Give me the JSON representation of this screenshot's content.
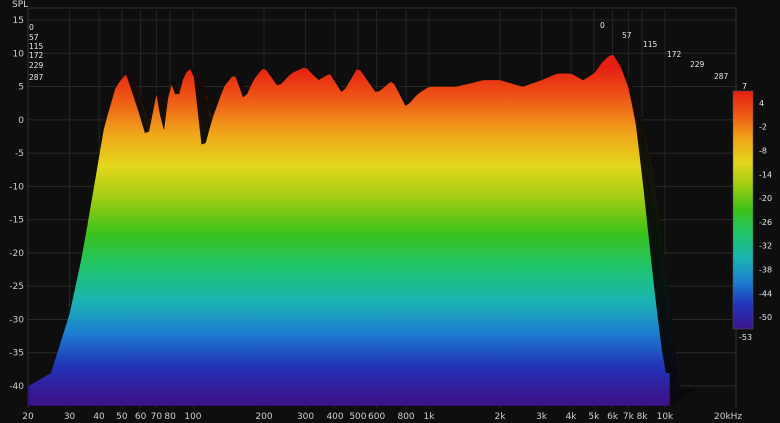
{
  "chart_data": {
    "type": "area",
    "title": "",
    "ylabel": "SPL",
    "xunit_label": "20kHz",
    "xscale": "log",
    "xlim": [
      20,
      20000
    ],
    "ylim": [
      -43,
      16
    ],
    "grid": true,
    "y_ticks": [
      15,
      10,
      5,
      0,
      -5,
      -10,
      -15,
      -20,
      -25,
      -30,
      -35,
      -40
    ],
    "x_ticks": [
      {
        "value": 20,
        "label": "20"
      },
      {
        "value": 30,
        "label": "30"
      },
      {
        "value": 40,
        "label": "40"
      },
      {
        "value": 50,
        "label": "50"
      },
      {
        "value": 60,
        "label": "60"
      },
      {
        "value": 70,
        "label": "70"
      },
      {
        "value": 80,
        "label": "80"
      },
      {
        "value": 100,
        "label": "100"
      },
      {
        "value": 200,
        "label": "200"
      },
      {
        "value": 300,
        "label": "300"
      },
      {
        "value": 400,
        "label": "400"
      },
      {
        "value": 500,
        "label": "500"
      },
      {
        "value": 600,
        "label": "600"
      },
      {
        "value": 800,
        "label": "800"
      },
      {
        "value": 1000,
        "label": "1k"
      },
      {
        "value": 2000,
        "label": "2k"
      },
      {
        "value": 3000,
        "label": "3k"
      },
      {
        "value": 4000,
        "label": "4k"
      },
      {
        "value": 5000,
        "label": "5k"
      },
      {
        "value": 6000,
        "label": "6k"
      },
      {
        "value": 7000,
        "label": "7k"
      },
      {
        "value": 8000,
        "label": "8k"
      },
      {
        "value": 10000,
        "label": "10k"
      }
    ],
    "slice_labels": [
      "0",
      "57",
      "115",
      "172",
      "229",
      "287"
    ],
    "colorbar": {
      "max": 7,
      "min": -53,
      "ticks": [
        4,
        -2,
        -8,
        -14,
        -20,
        -26,
        -32,
        -38,
        -44,
        -50
      ],
      "top_label": "7",
      "bottom_label": "-53"
    },
    "front_envelope": {
      "freq_hz": [
        20,
        25,
        30,
        34,
        38,
        42,
        47,
        52,
        58,
        64,
        70,
        75,
        80,
        86,
        92,
        100,
        110,
        120,
        135,
        150,
        165,
        180,
        200,
        230,
        260,
        300,
        340,
        380,
        430,
        500,
        600,
        700,
        800,
        900,
        1000,
        1300,
        1700,
        2000,
        2500,
        3000,
        3500,
        4000,
        4500,
        5000,
        5500,
        6000,
        6500,
        7000,
        7500,
        8000,
        9000,
        10000
      ],
      "spl_db": [
        -40,
        -38,
        -29,
        -20,
        -10,
        -1,
        5,
        7,
        2,
        -3,
        4,
        -2,
        6,
        3,
        7,
        8,
        -5,
        0,
        5,
        7,
        3,
        6,
        8,
        5,
        7,
        8,
        6,
        7,
        4,
        8,
        4,
        6,
        2,
        4,
        5,
        5,
        6,
        6,
        5,
        6,
        7,
        7,
        6,
        7,
        9,
        10,
        8,
        5,
        0,
        -8,
        -25,
        -38
      ]
    },
    "color_scale": [
      "#3a148c",
      "#2233b8",
      "#1c7fd0",
      "#1bb5b0",
      "#1fc46a",
      "#3cc21a",
      "#9ccc13",
      "#e3d71b",
      "#f0a41a",
      "#ee5a16",
      "#e51d12"
    ]
  }
}
